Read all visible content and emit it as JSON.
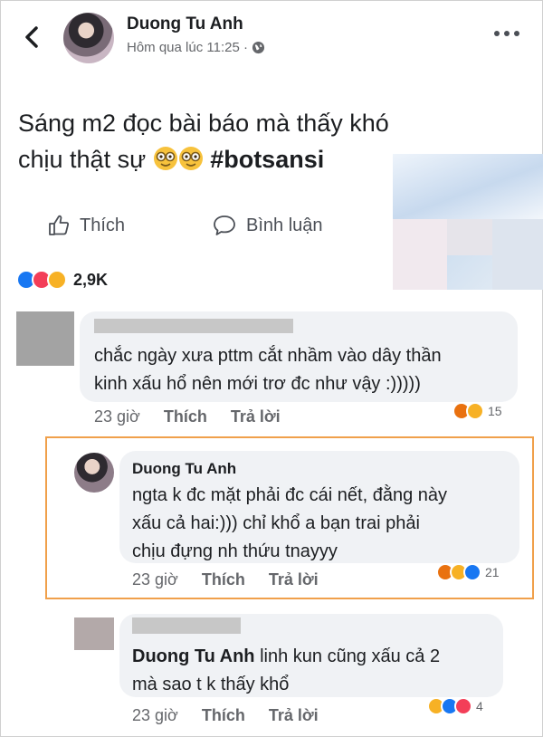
{
  "post": {
    "author": "Duong Tu Anh",
    "timestamp": "Hôm qua lúc 11:25 ·",
    "text_line1": "Sáng m2 đọc bài báo mà thấy khó",
    "text_line2": "chịu thật sự",
    "hashtag": "#botsansi",
    "actions": {
      "like": "Thích",
      "comment": "Bình luận"
    },
    "reaction_count": "2,9K"
  },
  "comments": [
    {
      "text": "chắc ngày xưa pttm cắt nhầm vào dây thần kinh xấu hổ nên mới trơ đc như vậy :)))))",
      "line1": "chắc ngày xưa pttm cắt nhầm vào dây thần",
      "line2": "kinh xấu hổ nên mới trơ đc như vậy :)))))",
      "time": "23 giờ",
      "like": "Thích",
      "reply": "Trả lời",
      "reactions": "15"
    },
    {
      "author": "Duong Tu Anh",
      "line1": "ngta k đc mặt phải đc cái nết, đằng này",
      "line2": "xấu cả hai:))) chỉ khổ a bạn trai phải",
      "line3": "chịu đựng nh thứu tnayyy",
      "time": "23 giờ",
      "like": "Thích",
      "reply": "Trả lời",
      "reactions": "21"
    },
    {
      "mention": "Duong Tu Anh",
      "line1_rest": " linh kun cũng xấu cả 2",
      "line2": "mà sao t k thấy khổ",
      "time": "23 giờ",
      "like": "Thích",
      "reply": "Trả lời",
      "reactions": "4"
    }
  ],
  "colors": {
    "highlight": "#f0a04b",
    "like_blue": "#1877f2",
    "love_red": "#f33e58",
    "haha_yellow": "#f7b125"
  }
}
